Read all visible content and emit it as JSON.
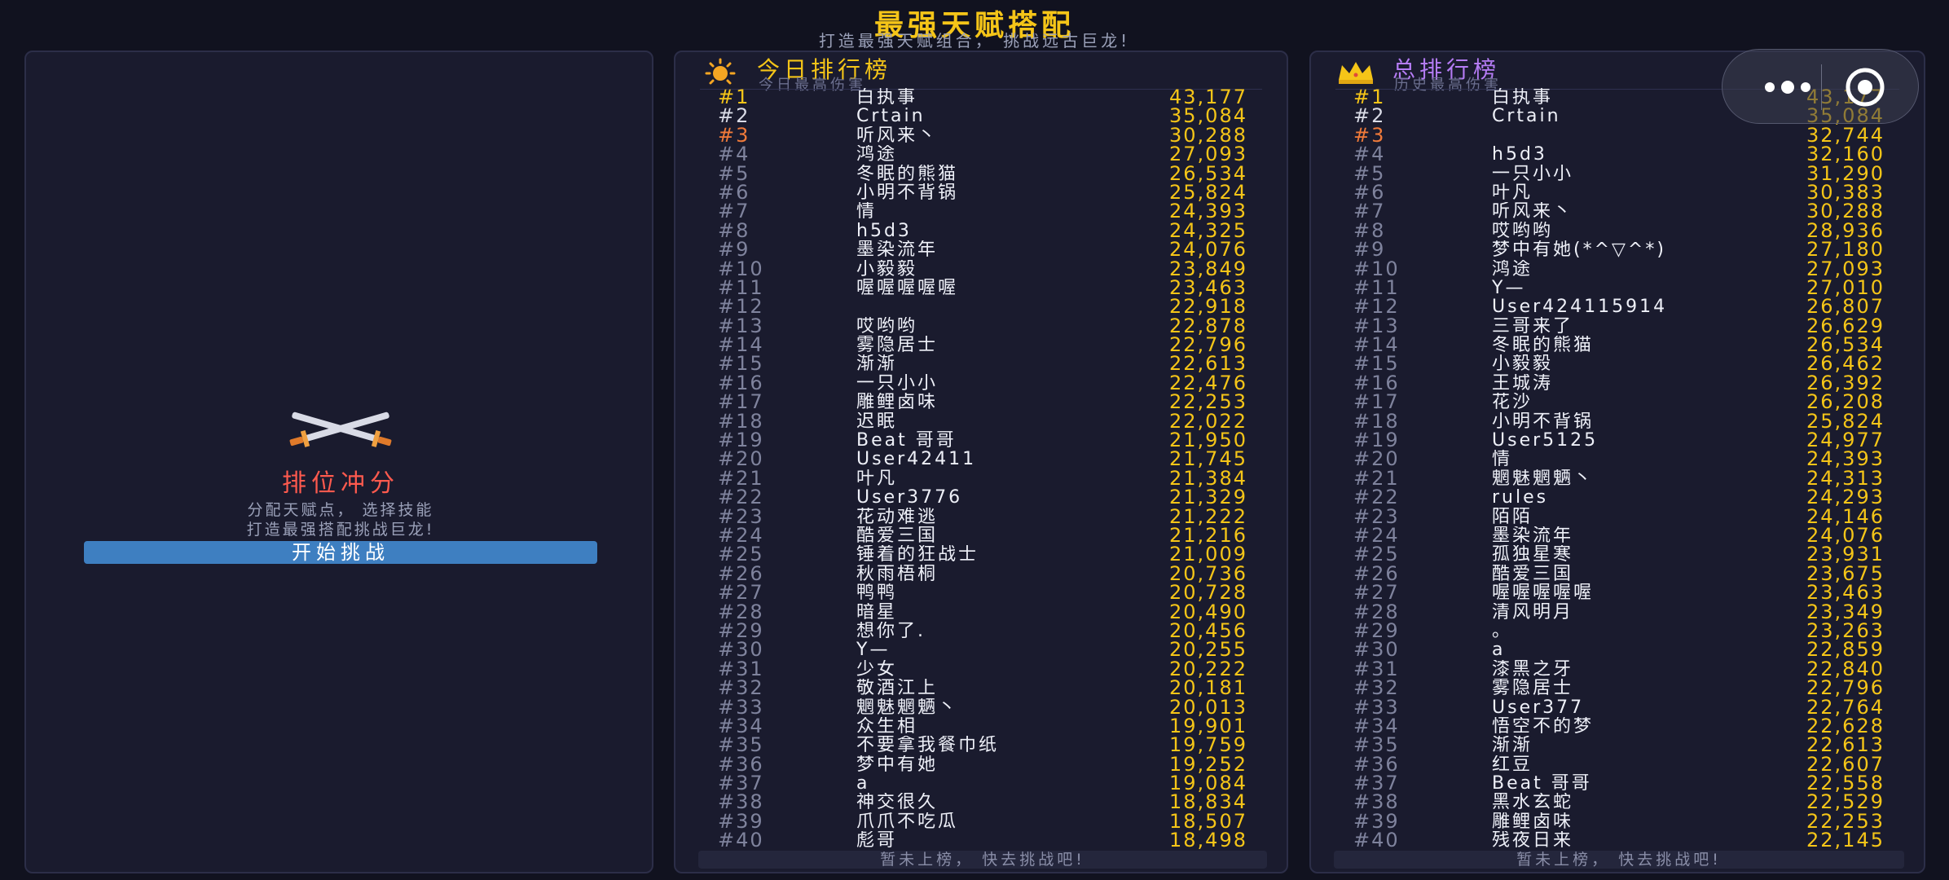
{
  "header": {
    "title": "最强天赋搭配",
    "subtitle": "打造最强天赋组合， 挑战远古巨龙!"
  },
  "start": {
    "title": "排位冲分",
    "desc_line1": "分配天赋点， 选择技能",
    "desc_line2": "打造最强搭配挑战巨龙!",
    "button": "开始挑战",
    "icon": "crossed-swords-icon"
  },
  "today": {
    "title": "今日排行榜",
    "subtitle": "今日最高伤害",
    "icon": "sun-icon",
    "footer": "暂未上榜， 快去挑战吧!",
    "rows": [
      {
        "rank": "#1",
        "name": "白执事",
        "score": "43,177"
      },
      {
        "rank": "#2",
        "name": "Crtain",
        "score": "35,084"
      },
      {
        "rank": "#3",
        "name": "听风来丶",
        "score": "30,288"
      },
      {
        "rank": "#4",
        "name": "鸿途",
        "score": "27,093"
      },
      {
        "rank": "#5",
        "name": "冬眠的熊猫",
        "score": "26,534"
      },
      {
        "rank": "#6",
        "name": "小明不背锅",
        "score": "25,824"
      },
      {
        "rank": "#7",
        "name": "情",
        "score": "24,393"
      },
      {
        "rank": "#8",
        "name": "h5d3",
        "score": "24,325"
      },
      {
        "rank": "#9",
        "name": "墨染流年",
        "score": "24,076"
      },
      {
        "rank": "#10",
        "name": "小毅毅",
        "score": "23,849"
      },
      {
        "rank": "#11",
        "name": "喔喔喔喔喔",
        "score": "23,463"
      },
      {
        "rank": "#12",
        "name": "",
        "score": "22,918"
      },
      {
        "rank": "#13",
        "name": "哎哟哟",
        "score": "22,878"
      },
      {
        "rank": "#14",
        "name": "雾隐居士",
        "score": "22,796"
      },
      {
        "rank": "#15",
        "name": "渐渐",
        "score": "22,613"
      },
      {
        "rank": "#16",
        "name": "一只小小",
        "score": "22,476"
      },
      {
        "rank": "#17",
        "name": "雕鲤卤味",
        "score": "22,253"
      },
      {
        "rank": "#18",
        "name": "迟眠",
        "score": "22,022"
      },
      {
        "rank": "#19",
        "name": "Beat 哥哥",
        "score": "21,950"
      },
      {
        "rank": "#20",
        "name": "User42411",
        "score": "21,745"
      },
      {
        "rank": "#21",
        "name": "叶凡",
        "score": "21,384"
      },
      {
        "rank": "#22",
        "name": "User3776",
        "score": "21,329"
      },
      {
        "rank": "#23",
        "name": "花动难逃",
        "score": "21,222"
      },
      {
        "rank": "#24",
        "name": "酷爱三国",
        "score": "21,216"
      },
      {
        "rank": "#25",
        "name": "锤着的狂战士",
        "score": "21,009"
      },
      {
        "rank": "#26",
        "name": "秋雨梧桐",
        "score": "20,736"
      },
      {
        "rank": "#27",
        "name": "鸭鸭",
        "score": "20,728"
      },
      {
        "rank": "#28",
        "name": "暗星",
        "score": "20,490"
      },
      {
        "rank": "#29",
        "name": "想你了.",
        "score": "20,456"
      },
      {
        "rank": "#30",
        "name": "Y—",
        "score": "20,255"
      },
      {
        "rank": "#31",
        "name": "少女",
        "score": "20,222"
      },
      {
        "rank": "#32",
        "name": "敬酒江上",
        "score": "20,181"
      },
      {
        "rank": "#33",
        "name": "魍魅魍魉丶",
        "score": "20,013"
      },
      {
        "rank": "#34",
        "name": "众生相",
        "score": "19,901"
      },
      {
        "rank": "#35",
        "name": "不要拿我餐巾纸",
        "score": "19,759"
      },
      {
        "rank": "#36",
        "name": "梦中有她",
        "score": "19,252"
      },
      {
        "rank": "#37",
        "name": "a",
        "score": "19,084"
      },
      {
        "rank": "#38",
        "name": "神交很久",
        "score": "18,834"
      },
      {
        "rank": "#39",
        "name": "爪爪不吃瓜",
        "score": "18,507"
      },
      {
        "rank": "#40",
        "name": "彪哥",
        "score": "18,498"
      }
    ]
  },
  "total": {
    "title": "总排行榜",
    "subtitle": "历史最高伤害",
    "icon": "crown-icon",
    "footer": "暂未上榜， 快去挑战吧!",
    "rows": [
      {
        "rank": "#1",
        "name": "白执事",
        "score": "43,177"
      },
      {
        "rank": "#2",
        "name": "Crtain",
        "score": "35,084"
      },
      {
        "rank": "#3",
        "name": "",
        "score": "32,744"
      },
      {
        "rank": "#4",
        "name": "h5d3",
        "score": "32,160"
      },
      {
        "rank": "#5",
        "name": "一只小小",
        "score": "31,290"
      },
      {
        "rank": "#6",
        "name": "叶凡",
        "score": "30,383"
      },
      {
        "rank": "#7",
        "name": "听风来丶",
        "score": "30,288"
      },
      {
        "rank": "#8",
        "name": "哎哟哟",
        "score": "28,936"
      },
      {
        "rank": "#9",
        "name": "梦中有她(*^▽^*)",
        "score": "27,180"
      },
      {
        "rank": "#10",
        "name": "鸿途",
        "score": "27,093"
      },
      {
        "rank": "#11",
        "name": "Y—",
        "score": "27,010"
      },
      {
        "rank": "#12",
        "name": "User424115914",
        "score": "26,807"
      },
      {
        "rank": "#13",
        "name": "三哥来了",
        "score": "26,629"
      },
      {
        "rank": "#14",
        "name": "冬眠的熊猫",
        "score": "26,534"
      },
      {
        "rank": "#15",
        "name": "小毅毅",
        "score": "26,462"
      },
      {
        "rank": "#16",
        "name": "王城涛",
        "score": "26,392"
      },
      {
        "rank": "#17",
        "name": "花沙",
        "score": "26,208"
      },
      {
        "rank": "#18",
        "name": "小明不背锅",
        "score": "25,824"
      },
      {
        "rank": "#19",
        "name": "User5125",
        "score": "24,977"
      },
      {
        "rank": "#20",
        "name": "情",
        "score": "24,393"
      },
      {
        "rank": "#21",
        "name": "魍魅魍魉丶",
        "score": "24,313"
      },
      {
        "rank": "#22",
        "name": "rules",
        "score": "24,293"
      },
      {
        "rank": "#23",
        "name": "陌陌",
        "score": "24,146"
      },
      {
        "rank": "#24",
        "name": "墨染流年",
        "score": "24,076"
      },
      {
        "rank": "#25",
        "name": "孤独星寒",
        "score": "23,931"
      },
      {
        "rank": "#26",
        "name": "酷爱三国",
        "score": "23,675"
      },
      {
        "rank": "#27",
        "name": "喔喔喔喔喔",
        "score": "23,463"
      },
      {
        "rank": "#28",
        "name": "清风明月",
        "score": "23,349"
      },
      {
        "rank": "#29",
        "name": "。",
        "score": "23,263"
      },
      {
        "rank": "#30",
        "name": "a",
        "score": "22,859"
      },
      {
        "rank": "#31",
        "name": "漆黑之牙",
        "score": "22,840"
      },
      {
        "rank": "#32",
        "name": "雾隐居士",
        "score": "22,796"
      },
      {
        "rank": "#33",
        "name": "User377",
        "score": "22,764"
      },
      {
        "rank": "#34",
        "name": "悟空不的梦",
        "score": "22,628"
      },
      {
        "rank": "#35",
        "name": "渐渐",
        "score": "22,613"
      },
      {
        "rank": "#36",
        "name": "红豆",
        "score": "22,607"
      },
      {
        "rank": "#37",
        "name": "Beat 哥哥",
        "score": "22,558"
      },
      {
        "rank": "#38",
        "name": "黑水玄蛇",
        "score": "22,529"
      },
      {
        "rank": "#39",
        "name": "雕鲤卤味",
        "score": "22,253"
      },
      {
        "rank": "#40",
        "name": "残夜日来",
        "score": "22,145"
      }
    ]
  },
  "capsule": {
    "more_icon": "more-dots-icon",
    "close_icon": "target-close-icon"
  }
}
